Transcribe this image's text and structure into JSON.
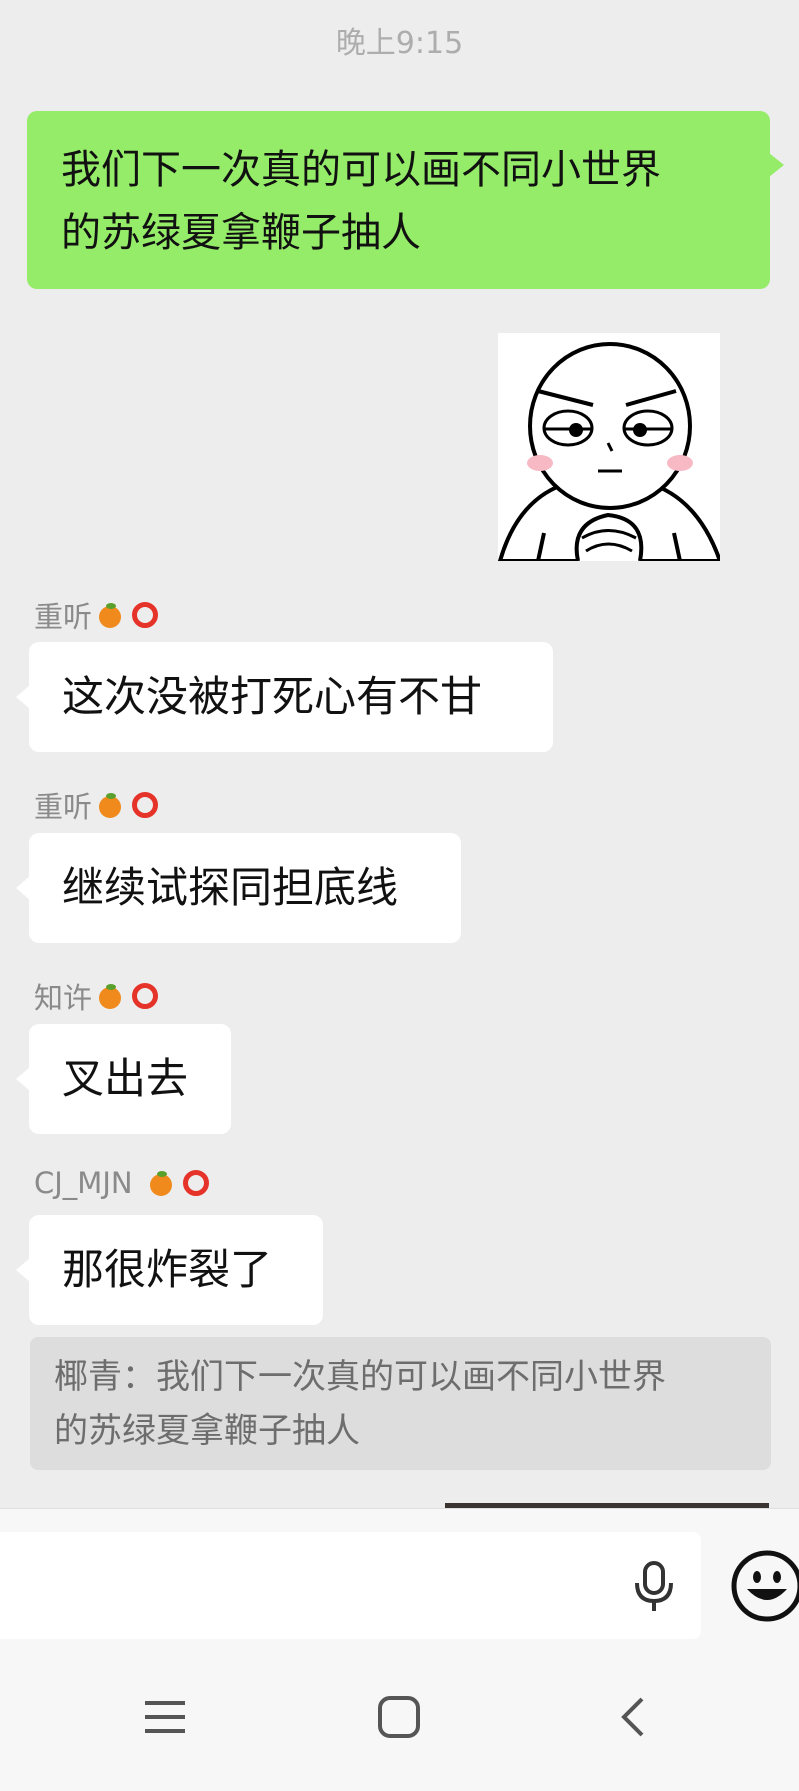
{
  "status": {
    "time": "晚上9:15"
  },
  "messages": [
    {
      "side": "right",
      "type": "text",
      "lines": [
        "我们下一次真的可以画不同小世界",
        "的苏绿夏拿鞭子抽人"
      ]
    },
    {
      "side": "right",
      "type": "sticker",
      "sticker": "determined-face-sticker"
    },
    {
      "side": "left",
      "sender": "重听",
      "text": "这次没被打死心有不甘"
    },
    {
      "side": "left",
      "sender": "重听",
      "text": "继续试探同担底线"
    },
    {
      "side": "left",
      "sender": "知许",
      "text": "叉出去"
    },
    {
      "side": "left",
      "sender": "CJ_MJN",
      "text": "那很炸裂了"
    }
  ],
  "quote": {
    "lines": [
      "椰青：我们下一次真的可以画不同小世界",
      "的苏绿夏拿鞭子抽人"
    ]
  },
  "input": {
    "value": "",
    "icons": [
      "microphone-icon",
      "emoji-icon"
    ]
  },
  "navbar": {
    "icons": [
      "menu-icon",
      "home-icon",
      "back-icon"
    ]
  },
  "colors": {
    "background": "#ededed",
    "outgoing_bubble": "#95ec69",
    "incoming_bubble": "#ffffff",
    "quote_bg": "#dddddd"
  }
}
